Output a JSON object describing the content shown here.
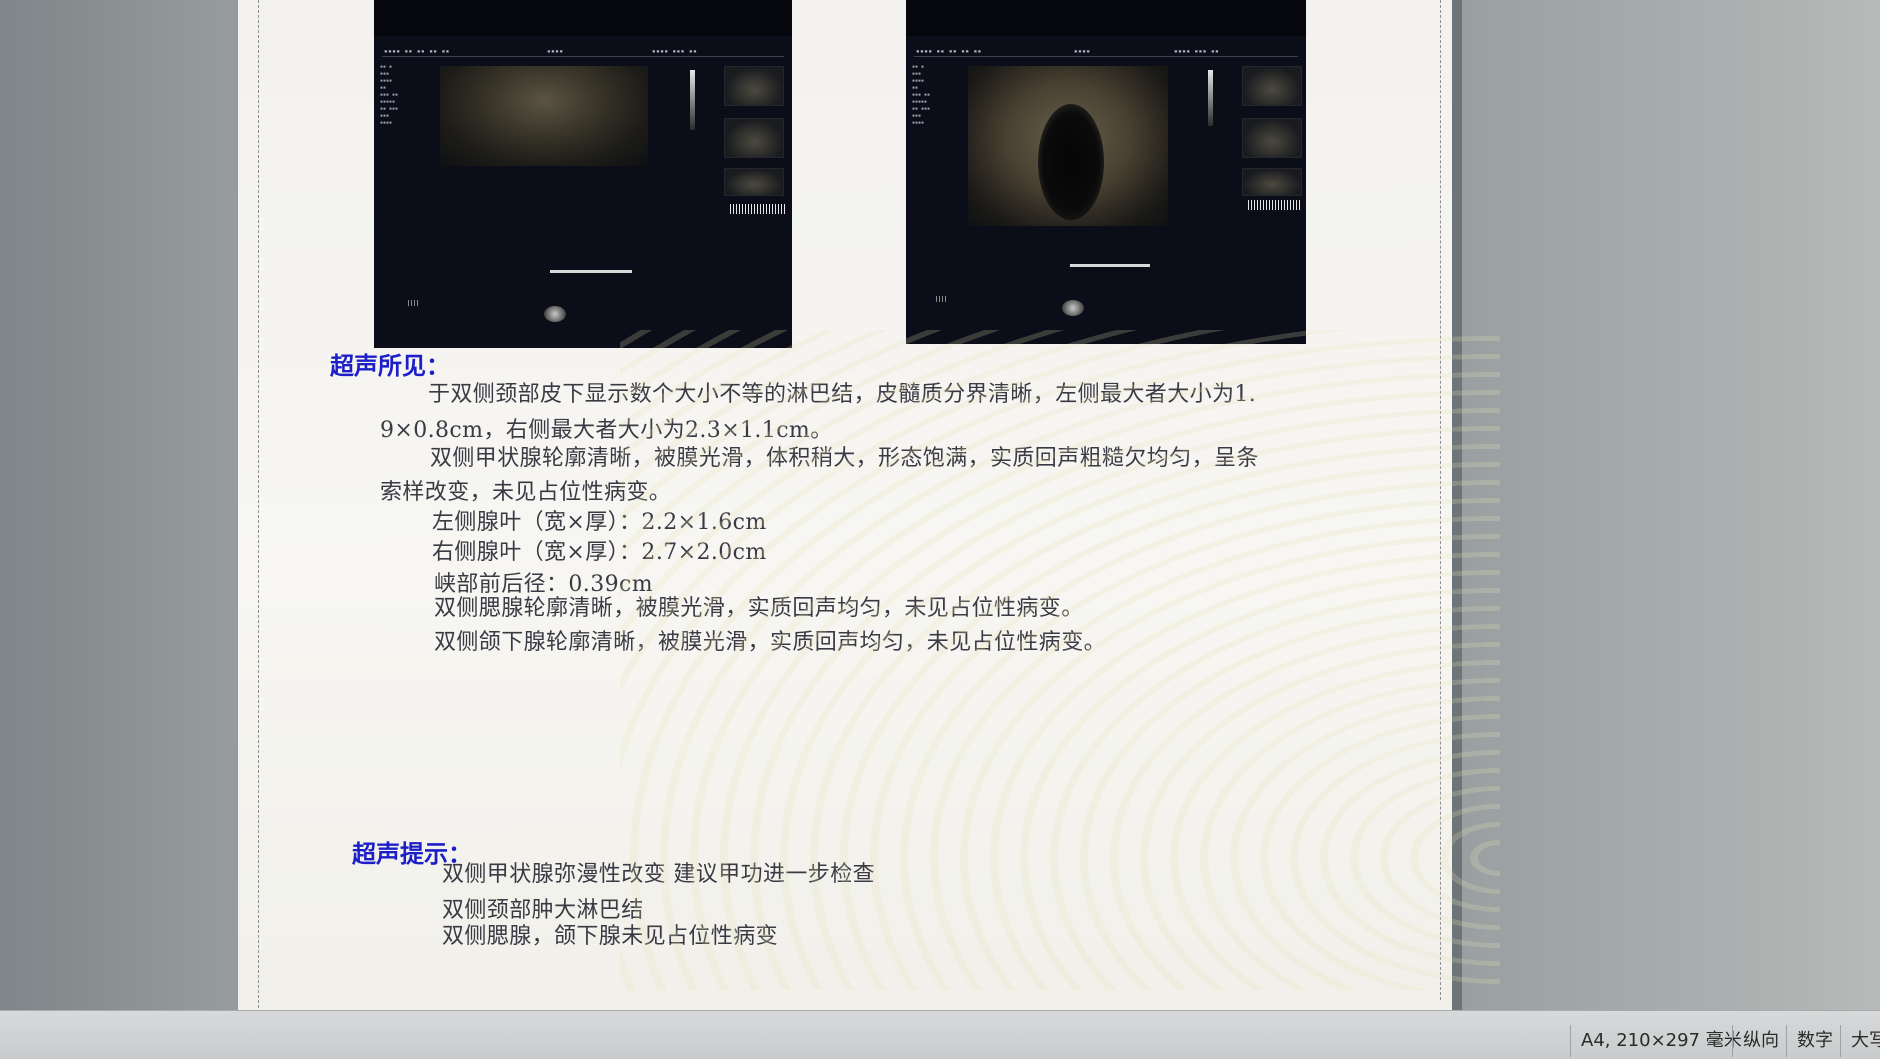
{
  "findings": {
    "title": "超声所见：",
    "lines": [
      "于双侧颈部皮下显示数个大小不等的淋巴结，皮髓质分界清晰，左侧最大者大小为1.",
      "9×0.8cm，右侧最大者大小为2.3×1.1cm。",
      "双侧甲状腺轮廓清晰，被膜光滑，体积稍大，形态饱满，实质回声粗糙欠均匀，呈条",
      "索样改变，未见占位性病变。",
      "左侧腺叶（宽×厚）：2.2×1.6cm",
      "右侧腺叶（宽×厚）：2.7×2.0cm",
      "峡部前后径：0.39cm",
      "双侧腮腺轮廓清晰，被膜光滑，实质回声均匀，未见占位性病变。",
      "双侧颌下腺轮廓清晰，被膜光滑，实质回声均匀，未见占位性病变。"
    ]
  },
  "impression": {
    "title": "超声提示：",
    "lines": [
      "双侧甲状腺弥漫性改变   建议甲功进一步检查",
      "双侧颈部肿大淋巴结",
      "双侧腮腺，颌下腺未见占位性病变"
    ]
  },
  "statusbar": {
    "paper": "A4, 210×297 毫米",
    "orientation": "纵向",
    "numlock": "数字",
    "capslock": "大写"
  },
  "colors": {
    "section_title": "#1c1fc8",
    "body_text": "#3a3a44"
  },
  "icons": [
    "ultrasound-image-left",
    "ultrasound-image-right"
  ]
}
